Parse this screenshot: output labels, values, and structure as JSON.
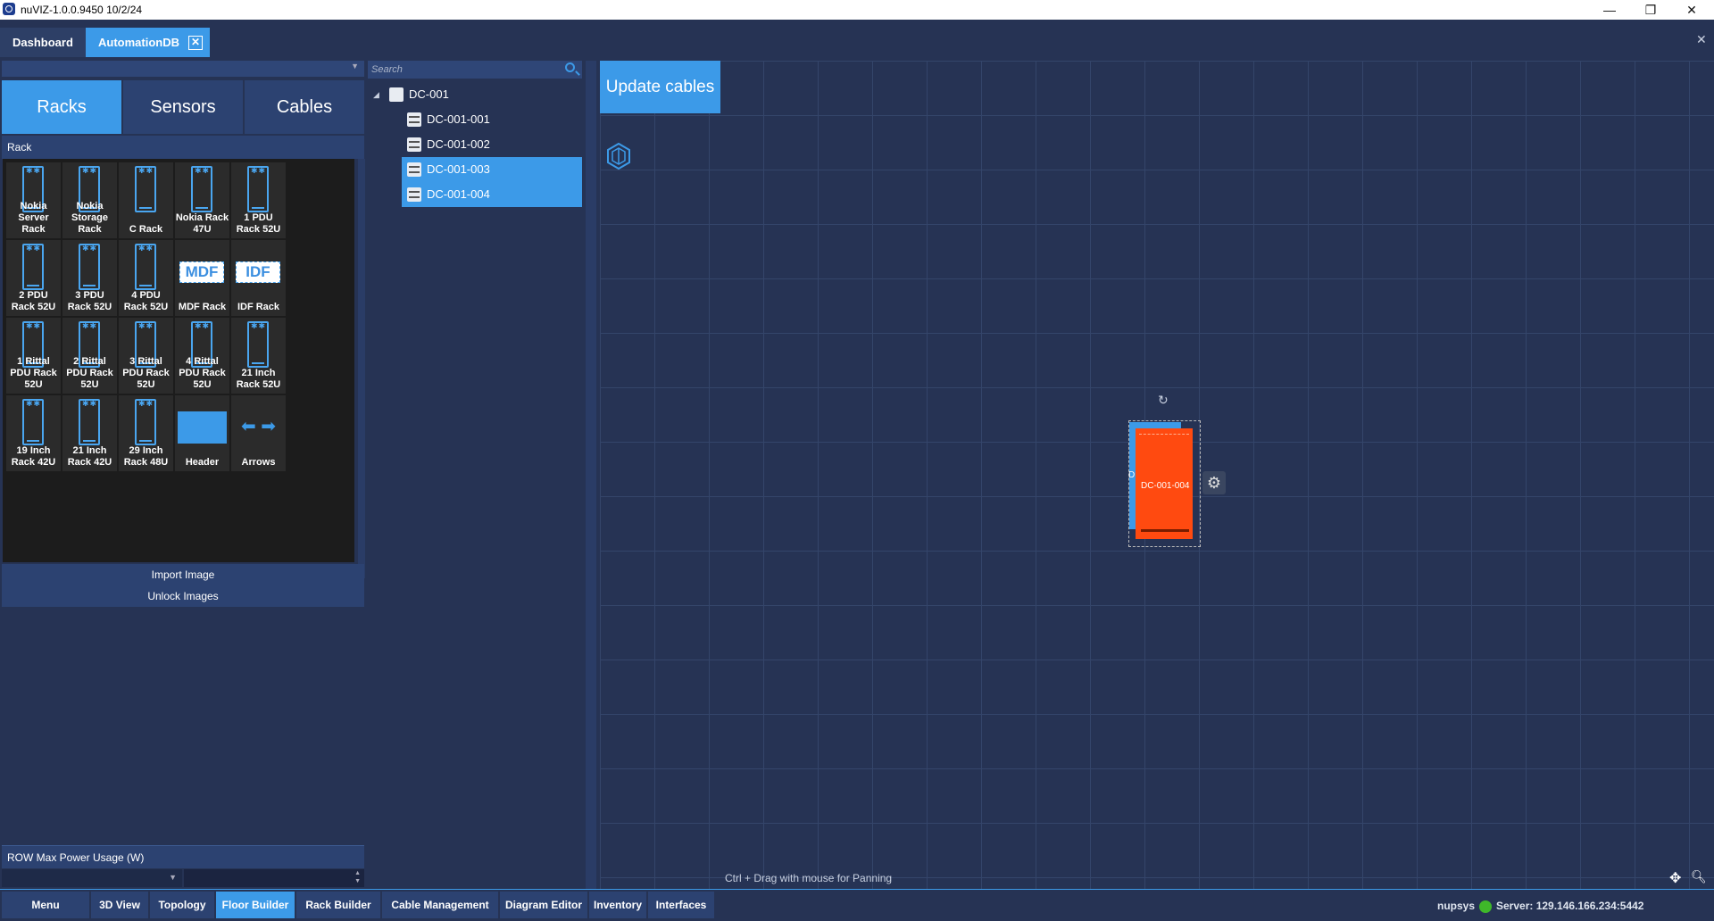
{
  "window": {
    "title": "nuVIZ-1.0.0.9450 10/2/24",
    "minimize": "—",
    "maximize": "❐",
    "close": "✕"
  },
  "doc_tabs": [
    {
      "label": "Dashboard"
    },
    {
      "label": "AutomationDB",
      "close": "✕"
    }
  ],
  "window_close": "✕",
  "categories": [
    "Racks",
    "Sensors",
    "Cables"
  ],
  "rack_section_title": "Rack",
  "palette": [
    {
      "label": "Nokia Server Rack",
      "icon": "rack-icon"
    },
    {
      "label": "Nokia Storage Rack",
      "icon": "rack-icon"
    },
    {
      "label": "C Rack",
      "icon": "rack-icon"
    },
    {
      "label": "Nokia Rack 47U",
      "icon": "rack-icon"
    },
    {
      "label": "1 PDU Rack 52U",
      "icon": "rack-icon"
    },
    {
      "label": "2 PDU Rack 52U",
      "icon": "rack-icon"
    },
    {
      "label": "3 PDU Rack 52U",
      "icon": "rack-icon"
    },
    {
      "label": "4 PDU Rack 52U",
      "icon": "rack-icon"
    },
    {
      "label": "MDF Rack",
      "icon": "mdf-icon",
      "icon_text": "MDF"
    },
    {
      "label": "IDF Rack",
      "icon": "idf-icon",
      "icon_text": "IDF"
    },
    {
      "label": "1 Rittal PDU Rack 52U",
      "icon": "rack-icon"
    },
    {
      "label": "2 Rittal PDU Rack 52U",
      "icon": "rack-icon"
    },
    {
      "label": "3 Rittal PDU Rack 52U",
      "icon": "rack-icon"
    },
    {
      "label": "4 Rittal PDU Rack 52U",
      "icon": "rack-icon"
    },
    {
      "label": "21 Inch Rack 52U",
      "icon": "rack-icon"
    },
    {
      "label": "19 Inch Rack 42U",
      "icon": "rack-icon"
    },
    {
      "label": "21 Inch Rack 42U",
      "icon": "rack-icon"
    },
    {
      "label": "29 Inch Rack 48U",
      "icon": "rack-icon"
    },
    {
      "label": "Header",
      "icon": "header-icon"
    },
    {
      "label": "Arrows",
      "icon": "arrows-icon"
    }
  ],
  "palette_actions": {
    "import_image": "Import Image",
    "unlock_images": "Unlock Images"
  },
  "power": {
    "title": "ROW Max Power Usage (W)",
    "value": ""
  },
  "tree": {
    "search_placeholder": "Search",
    "root": {
      "label": "DC-001",
      "expanded": true
    },
    "children": [
      {
        "label": "DC-001-001",
        "selected": false
      },
      {
        "label": "DC-001-002",
        "selected": false
      },
      {
        "label": "DC-001-003",
        "selected": true
      },
      {
        "label": "DC-001-004",
        "selected": true
      }
    ]
  },
  "canvas": {
    "update_cables": "Update cables",
    "rack_label": "DC-001-004",
    "rack_marker": "D",
    "panning_hint": "Ctrl + Drag with mouse for Panning",
    "colors": {
      "rack_fill": "#ff4a10",
      "selection": "#3c9ae8",
      "grid": "#34456a"
    }
  },
  "bottom_tabs": [
    {
      "label": "Menu"
    },
    {
      "label": "3D View"
    },
    {
      "label": "Topology"
    },
    {
      "label": "Floor Builder",
      "active": true
    },
    {
      "label": "Rack Builder"
    },
    {
      "label": "Cable Management"
    },
    {
      "label": "Diagram Editor"
    },
    {
      "label": "Inventory"
    },
    {
      "label": "Interfaces"
    }
  ],
  "status": {
    "user": "nupsys",
    "server": "Server: 129.146.166.234:5442",
    "connected_color": "#3fb82a"
  },
  "colors": {
    "accent": "#3c9ae8",
    "background": "#263354",
    "panel": "#2c4271"
  }
}
